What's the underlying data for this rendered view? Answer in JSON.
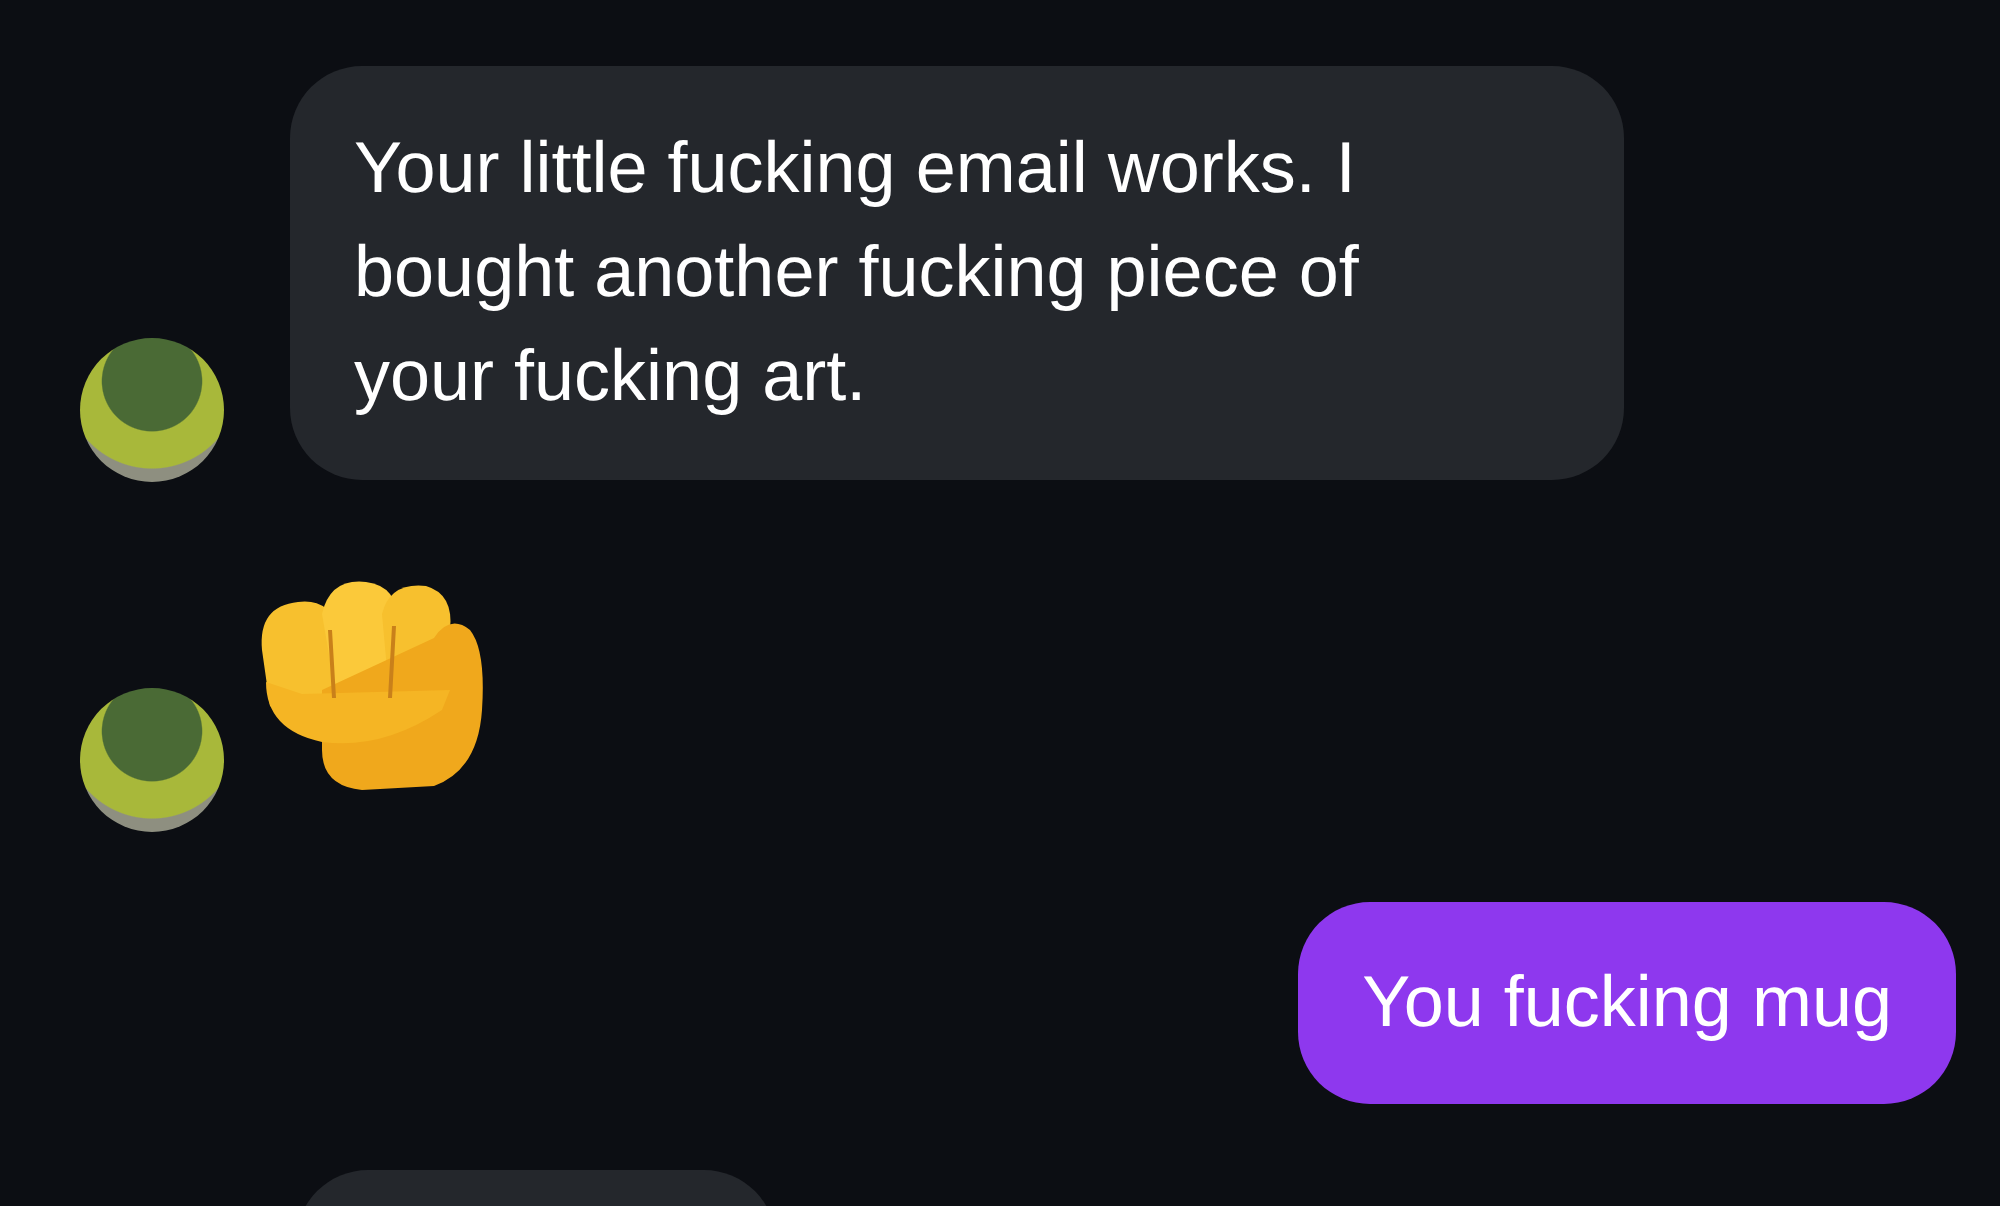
{
  "messages": [
    {
      "outgoing": false,
      "kind": "text",
      "text": "Your little fucking email works. I bought another fucking piece of your fucking art."
    },
    {
      "outgoing": false,
      "kind": "emoji"
    },
    {
      "outgoing": true,
      "kind": "text",
      "text": "You fucking mug"
    },
    {
      "outgoing": false,
      "kind": "cut-off"
    }
  ]
}
